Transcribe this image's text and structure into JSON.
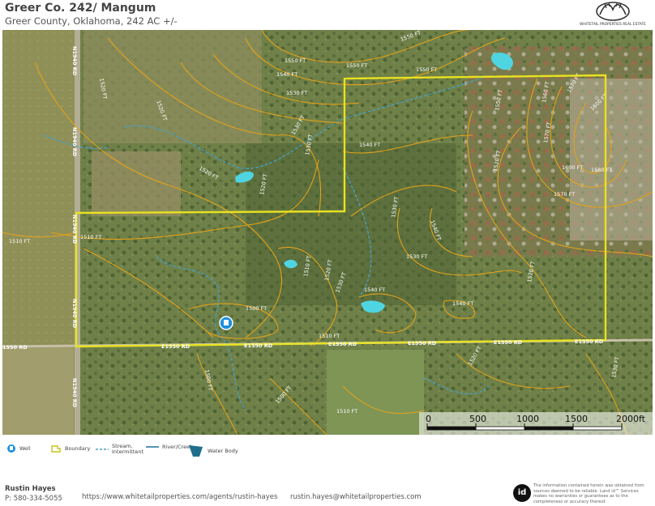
{
  "header": {
    "title": "Greer Co. 242/ Mangum",
    "subtitle": "Greer County, Oklahoma, 242 AC +/-",
    "logo_text": "WHITETAIL PROPERTIES REAL ESTATE"
  },
  "map": {
    "roads": [
      "N1940 RD",
      "N1940 RD",
      "N1940 RD",
      "N1940 RD",
      "N1940 RD",
      "E1550 RD",
      "E1550 RD",
      "E1550 RD",
      "E1550 RD",
      "E1550 RD",
      "E1550 RD",
      "1550 RD"
    ],
    "contours": [
      "1550 FT",
      "1550 FT",
      "1550 FT",
      "1540 FT",
      "1550 FT",
      "1530 FT",
      "1530 FT",
      "1520 FT",
      "1520 FT",
      "1540 FT",
      "1530 FT",
      "1530 FT",
      "1520 FT",
      "1550 FT",
      "1560 FT",
      "1570 FT",
      "1600 FT",
      "1570 FT",
      "1600 FT",
      "1580 FT",
      "1570 FT",
      "1530 FT",
      "1540 FT",
      "1510 FT",
      "1510 FT",
      "1510 FT",
      "1520 FT",
      "1530 FT",
      "1520 FT",
      "1530 FT",
      "1540 FT",
      "1500 FT",
      "1510 FT",
      "1520 FT",
      "1520 FT",
      "1500 FT",
      "1500 FT",
      "1510 FT",
      "1520 FT",
      "1530 FT",
      "1510 FT",
      "1550 FT",
      "1560 FT",
      "1580 FT",
      "1620 FT"
    ],
    "colors": {
      "boundary": "#e8e221",
      "contour": "#e3a21a",
      "water": "#4fd4e2",
      "stream": "#4a9fc4",
      "well": "#1d8fe0"
    }
  },
  "scalebar": {
    "labels": [
      "0",
      "500",
      "1000",
      "1500",
      "2000ft"
    ]
  },
  "legend": {
    "well": "Well",
    "boundary": "Boundary",
    "stream": "Stream, Intermittent",
    "river": "River/Creek",
    "water_body": "Water Body"
  },
  "footer": {
    "agent_name": "Rustin Hayes",
    "phone": "P: 580-334-5055",
    "url": "https://www.whitetailproperties.com/agents/rustin-hayes",
    "email": "rustin.hayes@whitetailproperties.com",
    "id_logo": "id",
    "disclaimer": "The information contained herein was obtained from sources deemed to be reliable. Land id™ Services makes no warranties or guarantees as to the completeness or accuracy thereof."
  }
}
